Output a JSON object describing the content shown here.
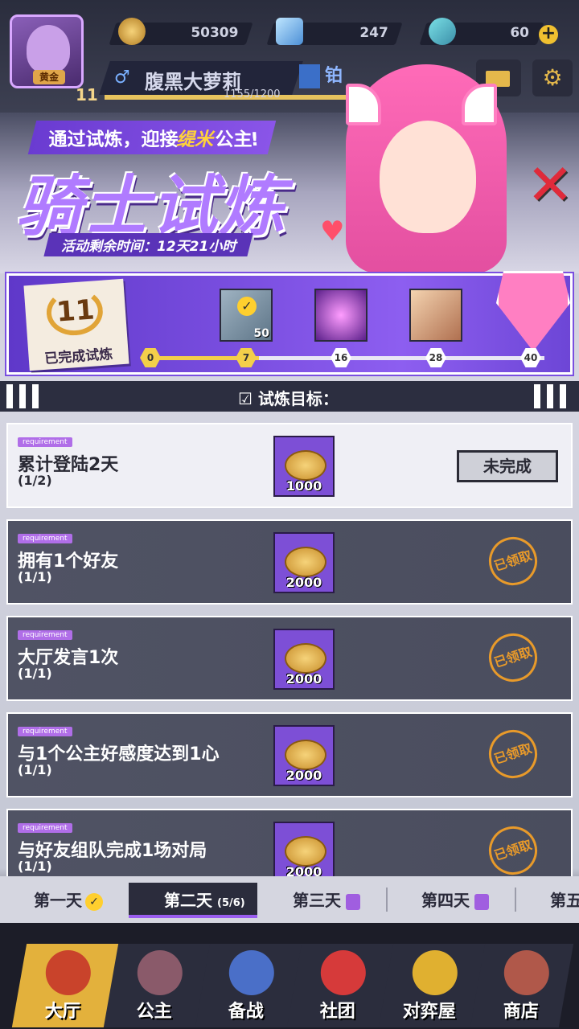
{
  "hud": {
    "level": "11",
    "avatar_tag": "黄金",
    "currency_gold": "50309",
    "currency_gem": "247",
    "currency_ticket": "60",
    "player_name": "腹黑大萝莉",
    "gender_symbol": "♂",
    "xp_text": "1155/1200",
    "rank_label": "铂"
  },
  "banner": {
    "subtitle_a": "通过试炼，迎接",
    "subtitle_b": "缇米",
    "subtitle_c": "公主!",
    "title": "骑士试炼",
    "timer": "活动剩余时间：12天21小时"
  },
  "progress": {
    "completed_count": "11",
    "completed_label": "已完成试炼",
    "fill_fraction": 0.275,
    "reward_count_1": "50",
    "nodes": [
      "0",
      "7",
      "16",
      "28",
      "40"
    ]
  },
  "section_title": "试炼目标：",
  "tasks": [
    {
      "req": "requirement",
      "name": "累计登陆2天",
      "count": "(1/2)",
      "amount": "1000",
      "status": "未完成"
    },
    {
      "req": "requirement",
      "name": "拥有1个好友",
      "count": "(1/1)",
      "amount": "2000",
      "status": "已领取"
    },
    {
      "req": "requirement",
      "name": "大厅发言1次",
      "count": "(1/1)",
      "amount": "2000",
      "status": "已领取"
    },
    {
      "req": "requirement",
      "name": "与1个公主好感度达到1心",
      "count": "(1/1)",
      "amount": "2000",
      "status": "已领取"
    },
    {
      "req": "requirement",
      "name": "与好友组队完成1场对局",
      "count": "(1/1)",
      "amount": "2000",
      "status": "已领取"
    }
  ],
  "days": {
    "d1": "第一天",
    "d2": "第二天",
    "d2_progress": "(5/6)",
    "d3": "第三天",
    "d4": "第四天",
    "d5": "第五"
  },
  "nav": [
    "大厅",
    "公主",
    "备战",
    "社团",
    "对弈屋",
    "商店"
  ],
  "colors": {
    "accent": "#8d5ef0",
    "gold": "#e3b13c"
  }
}
